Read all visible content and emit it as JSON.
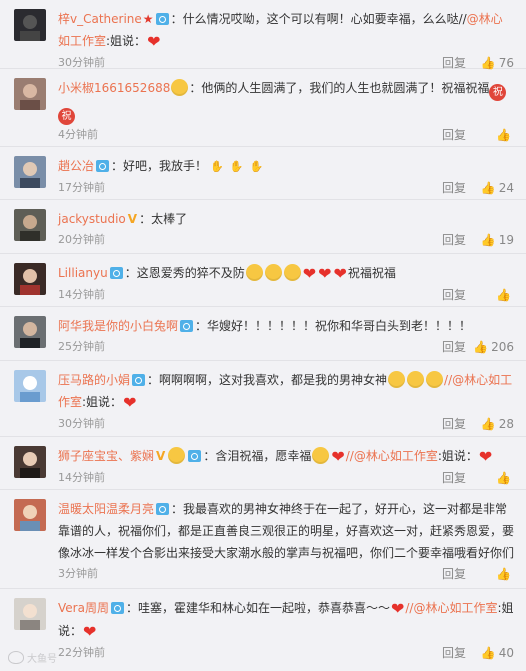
{
  "comments": [
    {
      "user": "梓v_Catherine",
      "star": "★",
      "text": "：什么情况哎呦，这个可以有啊！心如要幸福，么么哒//",
      "mention": "@林心如工作室",
      "tail": ":姐说：",
      "time": "30分钟前",
      "reply": "回复",
      "likes": "76",
      "avatar_color": "#2b2b30"
    },
    {
      "user": "小米椒1661652688",
      "text": "：他俩的人生圆满了，我们的人生也就圆满了！祝福祝福",
      "zhu": "祝",
      "time": "4分钟前",
      "reply": "回复",
      "likes": "",
      "avatar_color": "#9a7d71"
    },
    {
      "user": "趙公冶",
      "text": "：好吧，我放手！",
      "time": "17分钟前",
      "reply": "回复",
      "likes": "24",
      "avatar_color": "#7a8ea8"
    },
    {
      "user": "jackystudio",
      "text": "：太棒了",
      "time": "20分钟前",
      "reply": "回复",
      "likes": "19",
      "avatar_color": "#5e5e56"
    },
    {
      "user": "Lillianyu",
      "text": "：这恩爱秀的猝不及防",
      "tail": "祝福祝福",
      "time": "14分钟前",
      "reply": "回复",
      "likes": "",
      "avatar_color": "#3a2a26"
    },
    {
      "user": "阿华我是你的小白兔啊",
      "text": "：华嫂好！！！！！！祝你和华哥白头到老！！！！",
      "time": "25分钟前",
      "reply": "回复",
      "likes": "206",
      "avatar_color": "#6b6f72"
    },
    {
      "user": "压马路的小娟",
      "text": "：啊啊啊啊，这对我喜欢，都是我的男神女神",
      "mention": "//@林心如工作室",
      "tail": ":姐说：",
      "time": "30分钟前",
      "reply": "回复",
      "likes": "28",
      "avatar_color": "#a8c8e8"
    },
    {
      "user": "狮子座宝宝、紫娴",
      "text": "：含泪祝福，愿幸福",
      "mention": "//@林心如工作室",
      "tail": ":姐说：",
      "time": "14分钟前",
      "reply": "回复",
      "likes": "",
      "avatar_color": "#4a3a34"
    },
    {
      "user": "温暖太阳温柔月亮",
      "text": "：我最喜欢的男神女神终于在一起了，好开心，这一对都是非常靠谱的人，祝福你们，都是正直善良三观很正的明星，好喜欢这一对，赶紧秀恩爱，要像冰冰一样发个合影出来接受大家潮水般的掌声与祝福吧，你们二个要幸福哦看好你们",
      "time": "3分钟前",
      "reply": "回复",
      "likes": "",
      "avatar_color": "#c46a52"
    },
    {
      "user": "Vera周周",
      "text": "：哇塞，霍建华和林心如在一起啦，恭喜恭喜～～",
      "mention": "//@林心如工作室",
      "tail": ":姐说：",
      "time": "22分钟前",
      "reply": "回复",
      "likes": "40",
      "avatar_color": "#d6d2cc"
    }
  ],
  "watermark": "大鱼号",
  "icons": {
    "badge": "camera-badge-icon",
    "like": "thumbs-up-icon",
    "heart": "heart-icon",
    "emoji": "smiley-emoji-icon"
  },
  "colors": {
    "username": "#eb7350",
    "badge": "#4fb0e8",
    "heart": "#e6312b",
    "meta": "#999999",
    "background": "#f2f2f5"
  }
}
